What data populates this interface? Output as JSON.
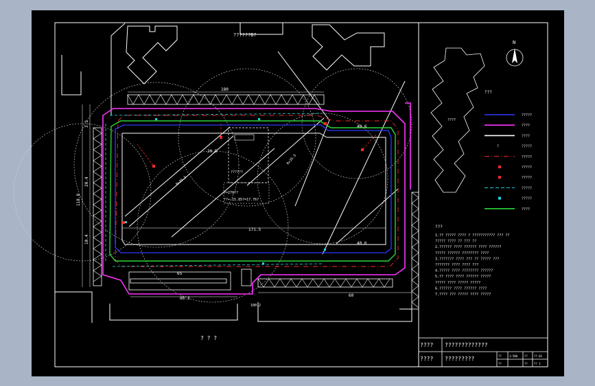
{
  "drawing": {
    "top_label": "??????B?",
    "dims": {
      "top_crane": "180",
      "left_total": "118.8",
      "left_sub": "20.4",
      "left_short": "3.3",
      "left_mid": "10.4",
      "right_upper": "40.6",
      "right_lower": "40.6",
      "top_small": "20.5",
      "bottom_inner": "171.5",
      "bottom_fence": "86.3",
      "bottom_road": "100.2",
      "bottom_total": "60",
      "bottom_left": "65",
      "sub_box_a": "13.5",
      "sub_box_b": "10.3"
    },
    "center_text_1": "??????",
    "center_text_2": "?=270??",
    "center_text_3": "??+-15.85?=17.76?",
    "bottom_note": "? ? ?",
    "crane_radius_1": "R=35.5",
    "crane_radius_2": "R=35.5",
    "north_label": "N"
  },
  "legend": {
    "title": "???",
    "items": [
      {
        "label": "?????",
        "color": "#2e3bff",
        "style": "solid"
      },
      {
        "label": "????",
        "color": "#ff33ff",
        "style": "solid"
      },
      {
        "label": "????",
        "color": "#ffffff",
        "style": "solid"
      },
      {
        "label": "?????",
        "color": "#ffffff",
        "style": "symbol"
      },
      {
        "label": "?????",
        "color": "#ff2a2a",
        "style": "dashdot"
      },
      {
        "label": "?????",
        "color": "#ff2a2a",
        "style": "dot"
      },
      {
        "label": "?????",
        "color": "#ff2a2a",
        "style": "dot"
      },
      {
        "label": "?????",
        "color": "#19d7e6",
        "style": "dash"
      },
      {
        "label": "?????",
        "color": "#19d7e6",
        "style": "dot"
      },
      {
        "label": "????",
        "color": "#2bd63a",
        "style": "solid"
      }
    ]
  },
  "notes": {
    "title": "???",
    "lines": [
      "1.??  ?????  ????  ?  ???????????  ???  ??",
      "  ?????  ????  ??  ???  ??",
      "2.??????  ????  ??????  ????  ??????",
      "  ?????  ??????  ????????  ????",
      "3.???????  ????  ???  ??  ?????  ???",
      "  ???????  ????  ????  ???",
      "4.?????  ????  ????????  ??????",
      "5.??  ????  ????  ??????  ?????",
      "  ?????  ????  ?????  ?????",
      "6.??????  ????  ??????  ????",
      "7.????  ???  ?????  ????  ?????"
    ]
  },
  "title_block": {
    "drawing_name_label": "????",
    "drawing_name": "?????????????",
    "project_name_label": "????",
    "project_name": "?????????",
    "small_cells": [
      "??",
      "1:500",
      "??",
      "??-01",
      "??",
      "",
      "??",
      "?? 1"
    ]
  }
}
